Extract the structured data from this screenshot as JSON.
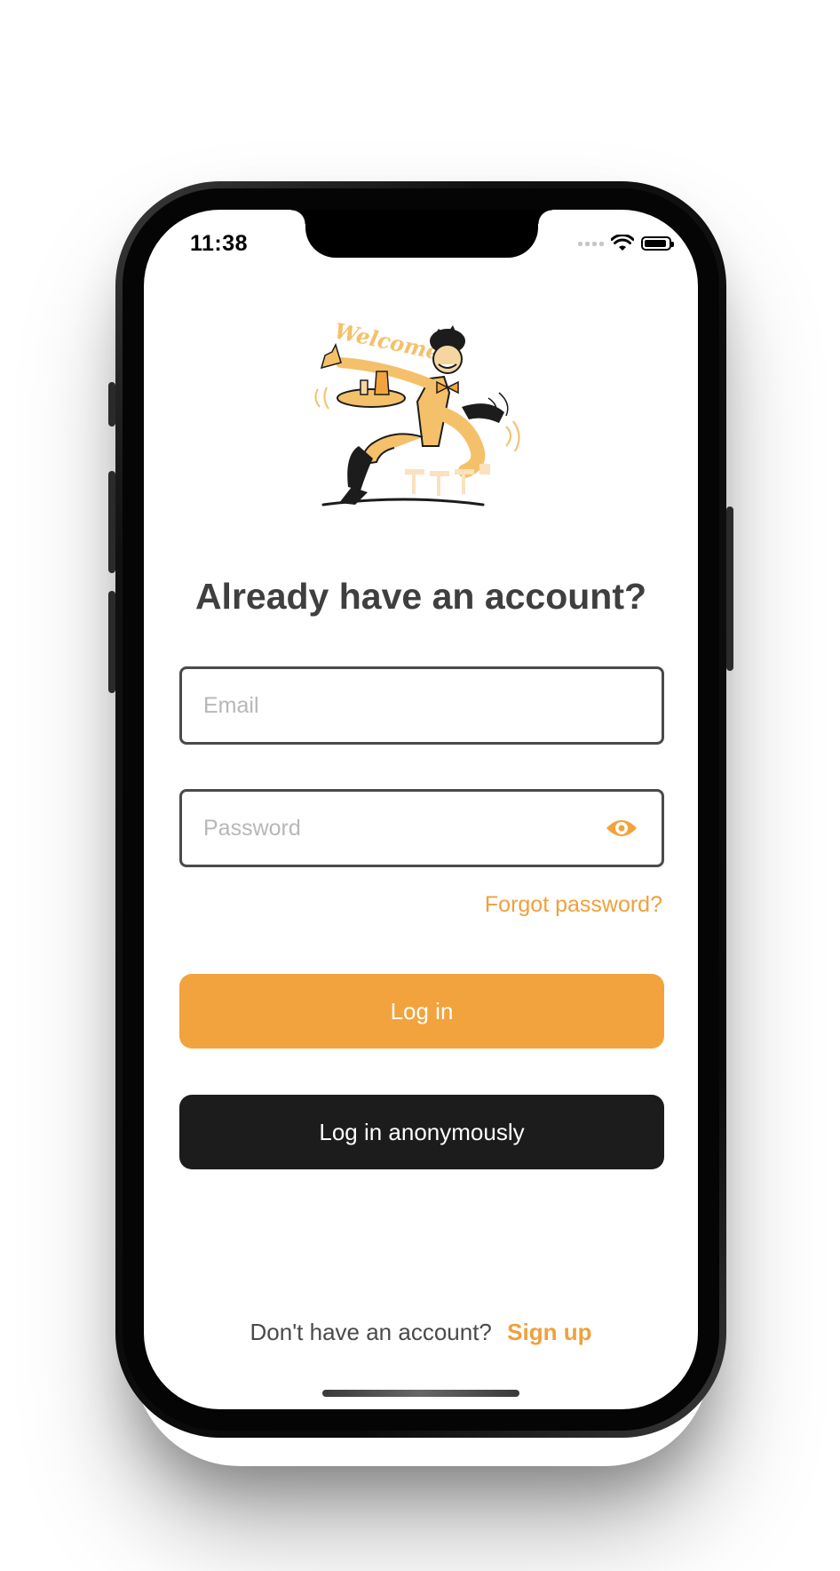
{
  "status_bar": {
    "time": "11:38",
    "wifi_icon": "wifi-icon",
    "battery_icon": "battery-icon"
  },
  "illustration": {
    "name": "welcome-waiter-illustration",
    "caption": "Welcome!"
  },
  "login": {
    "heading": "Already have an account?",
    "email_placeholder": "Email",
    "email_value": "",
    "password_placeholder": "Password",
    "password_value": "",
    "toggle_icon": "eye-icon",
    "forgot_label": "Forgot password?",
    "login_label": "Log in",
    "anon_label": "Log in anonymously"
  },
  "signup": {
    "prompt": "Don't have an account?",
    "link_label": "Sign up"
  },
  "colors": {
    "accent": "#F2A33D",
    "dark_button": "#1C1C1C",
    "heading": "#3F3F3F"
  }
}
